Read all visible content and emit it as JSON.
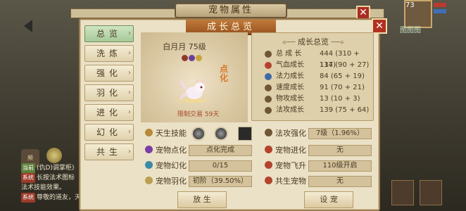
{
  "window": {
    "title": "宠物属性",
    "panel_title": "成长总览",
    "close_label": "✕"
  },
  "tabs": [
    {
      "label": "总览",
      "active": true
    },
    {
      "label": "洗炼",
      "active": false
    },
    {
      "label": "强化",
      "active": false
    },
    {
      "label": "羽化",
      "active": false
    },
    {
      "label": "进化",
      "active": false
    },
    {
      "label": "幻化",
      "active": false
    },
    {
      "label": "共生",
      "active": false
    }
  ],
  "pet": {
    "name": "白月月 75级",
    "dianhua_badge": "点化",
    "trade_limit": "限制交易 59天"
  },
  "growth": {
    "heading": "成长总览",
    "rows": [
      {
        "label": "总 成 长",
        "value": "444 (310 + 134)"
      },
      {
        "label": "气血成长",
        "value": "117 (90 + 27)"
      },
      {
        "label": "法力成长",
        "value": "84  (65 + 19)"
      },
      {
        "label": "速度成长",
        "value": "91  (70 + 21)"
      },
      {
        "label": "物攻成长",
        "value": "13  (10 + 3)"
      },
      {
        "label": "法攻成长",
        "value": "139 (75 + 64)"
      }
    ]
  },
  "attributes": {
    "innate_skill_label": "天生技能",
    "fa_gong_qiang_hua_label": "法攻强化",
    "fa_gong_qiang_hua_value": "7级（1.96%）",
    "dian_hua_label": "宠物点化",
    "dian_hua_value": "点化完成",
    "jin_hua_label": "宠物进化",
    "jin_hua_value": "无",
    "huan_hua_label": "宠物幻化",
    "huan_hua_value": "0/15",
    "fei_sheng_label": "宠物飞升",
    "fei_sheng_value": "110级开启",
    "yu_hua_label": "宠物羽化",
    "yu_hua_value": "初阶（39.50%）",
    "gong_sheng_label": "共生宠物",
    "gong_sheng_value": "无"
  },
  "background": {
    "chat_lines": [
      "(仇D)调掌柜)",
      "长按法术图标",
      "法术技能效果。",
      "尊敬的道友，天"
    ],
    "player_level": "73",
    "player_name": "图图图",
    "bottom_buttons": [
      "放 生",
      "设 宠"
    ]
  },
  "colors": {
    "active_tab": "#a6c998",
    "title_bar": "#b06a2e",
    "close": "#b2301f"
  }
}
